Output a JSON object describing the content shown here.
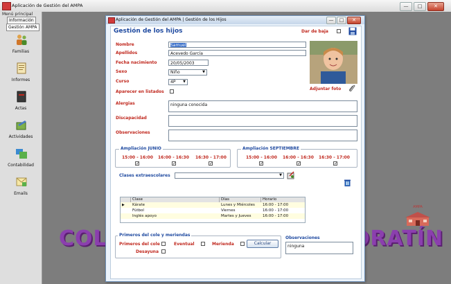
{
  "app": {
    "title": "Aplicación de Gestión del AMPA"
  },
  "menu": {
    "header": "Menú principal",
    "tabs": [
      "Información",
      "Gestión AMPA"
    ],
    "items": [
      {
        "label": "Familias",
        "icon": "family-icon"
      },
      {
        "label": "Informes",
        "icon": "report-icon"
      },
      {
        "label": "Actas",
        "icon": "minutes-icon"
      },
      {
        "label": "Actividades",
        "icon": "activities-icon"
      },
      {
        "label": "Contabilidad",
        "icon": "accounting-icon"
      },
      {
        "label": "Emails",
        "icon": "email-icon"
      }
    ]
  },
  "workspace": {
    "brand": "COLEGIO FERNANDEZ MORATÍN",
    "logo_caption": "AMPA"
  },
  "child_window": {
    "title": "Aplicación de Gestión del AMPA | Gestión de los Hijos"
  },
  "form": {
    "heading": "Gestión de los hijos",
    "baja_label": "Dar de baja",
    "fields": {
      "nombre": {
        "label": "Nombre",
        "value": "Samuel"
      },
      "apellidos": {
        "label": "Apellidos",
        "value": "Acevedo García"
      },
      "fecha": {
        "label": "Fecha nacimiento",
        "value": "20/05/2003"
      },
      "sexo": {
        "label": "Sexo",
        "value": "Niño"
      },
      "curso": {
        "label": "Curso",
        "value": "4P"
      },
      "listados": {
        "label": "Aparecer en listados"
      },
      "alergias": {
        "label": "Alergias",
        "value": "ninguna conocida"
      },
      "discapacidad": {
        "label": "Discapacidad",
        "value": ""
      },
      "observaciones": {
        "label": "Observaciones",
        "value": ""
      }
    },
    "photo_label": "Adjuntar foto",
    "ampliacion_junio": {
      "title": "Ampliación JUNIO",
      "slots": [
        "15:00 - 16:00",
        "16:00 - 16:30",
        "16:30 - 17:00"
      ]
    },
    "ampliacion_sept": {
      "title": "Ampliación SEPTIEMBRE",
      "slots": [
        "15:00 - 16:00",
        "16:00 - 16:30",
        "16:30 - 17:00"
      ]
    },
    "clases_label": "Clases extraescolares",
    "table": {
      "columns": [
        "Clase",
        "Días",
        "Horario"
      ],
      "rows": [
        [
          "Kárate",
          "Lunes y Miércoles",
          "16:00 - 17:00"
        ],
        [
          "Fútbol",
          "Viernes",
          "16:00 - 17:00"
        ],
        [
          "Inglés apoyo",
          "Martes y Jueves",
          "16:00 - 17:00"
        ]
      ]
    },
    "primeros": {
      "title": "Primeros del cole y meriendas",
      "primeros_label": "Primeros del cole",
      "eventual_label": "Eventual",
      "merienda_label": "Merienda",
      "desayuna_label": "Desayuna",
      "calc_label": "Calcular"
    },
    "obs2": {
      "title": "Observaciones",
      "value": "ninguna"
    }
  },
  "colors": {
    "label_red": "#c0281e",
    "group_blue": "#1f4aa0",
    "brand_purple": "#8b3fae"
  }
}
